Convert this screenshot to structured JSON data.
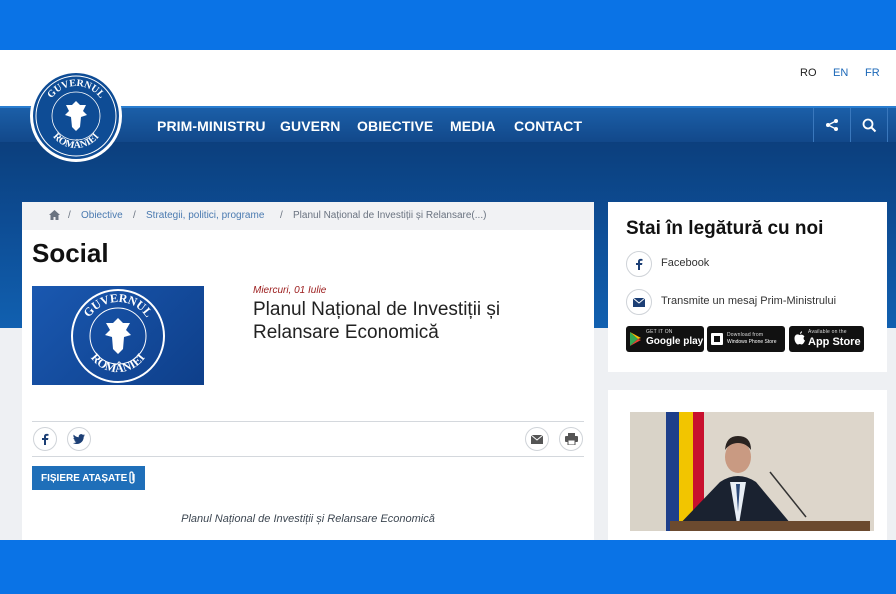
{
  "languages": {
    "ro": "RO",
    "en": "EN",
    "fr": "FR"
  },
  "nav": {
    "items": [
      "PRIM-MINISTRU",
      "GUVERN",
      "OBIECTIVE",
      "MEDIA",
      "CONTACT"
    ],
    "share_icon": "share-icon",
    "search_icon": "search-icon"
  },
  "logo": {
    "top_text": "GUVERNUL",
    "bottom_text": "ROMÂNIEI"
  },
  "breadcrumb": {
    "home_icon": "home-icon",
    "items": [
      "Obiective",
      "Strategii, politici, programe",
      "Planul Național de Investiții și Relansare(...)"
    ],
    "separator": "/"
  },
  "article": {
    "section_title": "Social",
    "date": "Miercuri, 01 Iulie",
    "headline": "Planul Național de Investiții și Relansare Economică",
    "attach_label": "FIȘIERE ATAȘATE",
    "caption": "Planul Național de Investiții și Relansare Economică"
  },
  "sidebar": {
    "title": "Stai în legătură cu noi",
    "facebook": "Facebook",
    "message": "Transmite un mesaj Prim-Ministrului",
    "stores": {
      "google_small": "GET IT ON",
      "google_big": "Google play",
      "windows_small": "Download from",
      "windows_big": "Windows Phone Store",
      "apple_small": "Available on the",
      "apple_big": "App Store"
    }
  },
  "colors": {
    "frame": "#0a73e6",
    "nav": "#1b5fa8",
    "accent": "#1f6fb9",
    "date": "#9b1b1b"
  }
}
